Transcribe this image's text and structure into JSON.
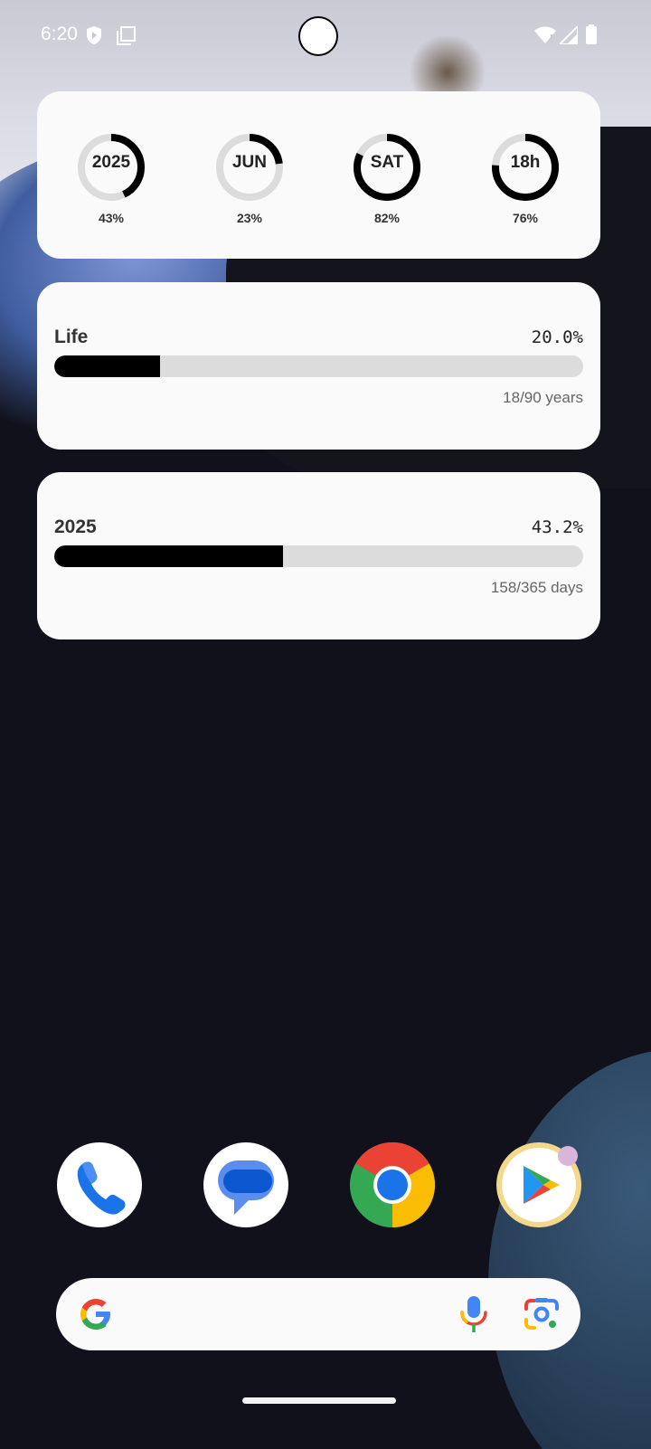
{
  "status_bar": {
    "time": "6:20"
  },
  "rings_widget": {
    "rings": [
      {
        "label": "2025",
        "percent_text": "43%",
        "value": 0.43
      },
      {
        "label": "JUN",
        "percent_text": "23%",
        "value": 0.23
      },
      {
        "label": "SAT",
        "percent_text": "82%",
        "value": 0.82
      },
      {
        "label": "18h",
        "percent_text": "76%",
        "value": 0.76
      }
    ]
  },
  "life_widget": {
    "title": "Life",
    "percent_text": "20.0%",
    "value": 0.2,
    "subtitle": "18/90 years"
  },
  "year_widget": {
    "title": "2025",
    "percent_text": "43.2%",
    "value": 0.432,
    "subtitle": "158/365 days"
  },
  "dock": {
    "apps": [
      {
        "name": "Phone",
        "icon": "phone-icon"
      },
      {
        "name": "Messages",
        "icon": "messages-icon"
      },
      {
        "name": "Chrome",
        "icon": "chrome-icon"
      },
      {
        "name": "Play Store",
        "icon": "play-store-icon"
      }
    ]
  },
  "search_bar": {
    "icons": [
      "google-logo-icon",
      "microphone-icon",
      "lens-icon"
    ]
  },
  "colors": {
    "ring_fill": "#000000",
    "ring_track": "#dcdcdc",
    "card_bg": "#fafafa"
  }
}
